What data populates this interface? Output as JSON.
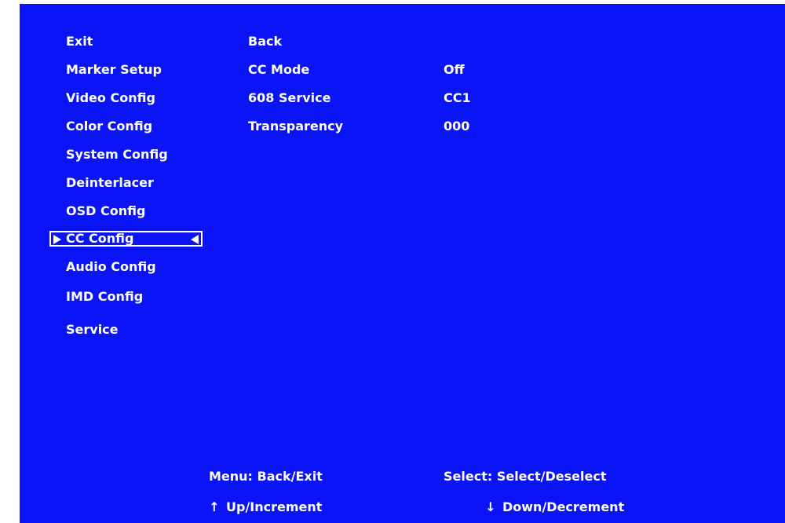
{
  "menu": {
    "items": [
      {
        "label": "Exit"
      },
      {
        "label": "Marker Setup"
      },
      {
        "label": "Video Config"
      },
      {
        "label": "Color Config"
      },
      {
        "label": "System Config"
      },
      {
        "label": "Deinterlacer"
      },
      {
        "label": "OSD Config"
      },
      {
        "label": "CC Config",
        "selected": true
      },
      {
        "label": "Audio Config"
      },
      {
        "label": "IMD Config"
      },
      {
        "label": "Service"
      }
    ]
  },
  "submenu": {
    "back_label": "Back",
    "settings": [
      {
        "label": "CC Mode",
        "value": "Off"
      },
      {
        "label": "608 Service",
        "value": "CC1"
      },
      {
        "label": "Transparency",
        "value": "000"
      }
    ]
  },
  "hints": {
    "menu": "Menu: Back/Exit",
    "select": "Select: Select/Deselect",
    "up": "Up/Increment",
    "down": "Down/Decrement"
  },
  "icons": {
    "up_arrow": "↑",
    "down_arrow": "↓"
  },
  "colors": {
    "background": "#0a14f5",
    "text": "#ffffff"
  }
}
